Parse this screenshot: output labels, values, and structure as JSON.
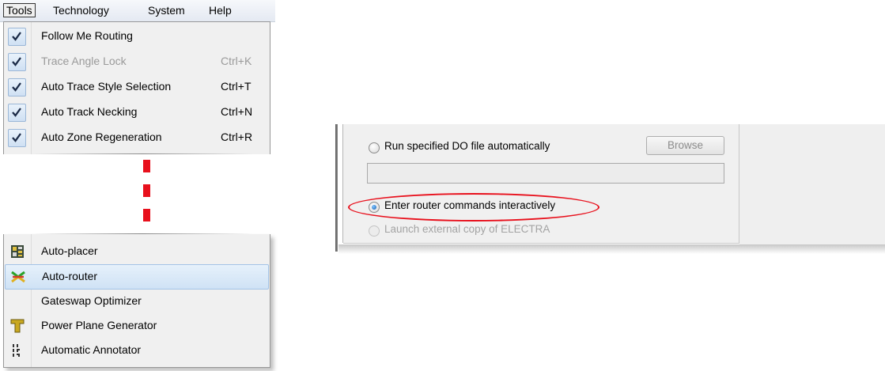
{
  "menubar": {
    "items": [
      "Tools",
      "Technology",
      "System",
      "Help"
    ]
  },
  "menu_top": [
    {
      "label": "Follow Me Routing",
      "shortcut": "",
      "checked": true,
      "enabled": true
    },
    {
      "label": "Trace Angle Lock",
      "shortcut": "Ctrl+K",
      "checked": true,
      "enabled": false
    },
    {
      "label": "Auto Trace Style Selection",
      "shortcut": "Ctrl+T",
      "checked": true,
      "enabled": true
    },
    {
      "label": "Auto Track Necking",
      "shortcut": "Ctrl+N",
      "checked": true,
      "enabled": true
    },
    {
      "label": "Auto Zone Regeneration",
      "shortcut": "Ctrl+R",
      "checked": true,
      "enabled": true
    }
  ],
  "menu_bottom": [
    {
      "label": "Auto-placer",
      "icon": "auto-placer-icon",
      "highlighted": false
    },
    {
      "label": "Auto-router",
      "icon": "auto-router-icon",
      "highlighted": true
    },
    {
      "label": "Gateswap Optimizer",
      "icon": "",
      "highlighted": false
    },
    {
      "label": "Power Plane Generator",
      "icon": "power-plane-icon",
      "highlighted": false
    },
    {
      "label": "Automatic Annotator",
      "icon": "annotator-icon",
      "highlighted": false
    }
  ],
  "dialog": {
    "option_run_do": "Run specified DO file automatically",
    "browse_label": "Browse",
    "do_file_path": "",
    "option_interactive": "Enter router commands interactively",
    "option_launch": "Launch external copy of ELECTRA",
    "selected_option": "interactive"
  },
  "colors": {
    "highlight_ellipse": "#e8101c",
    "cut_marker": "#e8101c",
    "menu_background": "#f0f0f0",
    "selection": "#cfe2f5"
  }
}
